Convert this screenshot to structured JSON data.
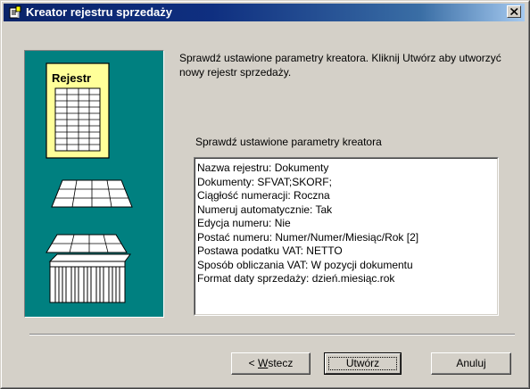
{
  "window": {
    "title": "Kreator rejestru sprzedaży",
    "title_icon": "wizard-document-icon",
    "close_icon": "close-icon"
  },
  "picture": {
    "label": "Rejestr",
    "background": "#008080",
    "highlight": "#ffff99"
  },
  "instructions": "Sprawdź ustawione parametry kreatora. Kliknij Utwórz aby utworzyć nowy rejestr sprzedaży.",
  "summary": {
    "label": "Sprawdź ustawione parametry kreatora",
    "items": [
      "Nazwa rejestru: Dokumenty",
      "Dokumenty: SFVAT;SKORF;",
      "Ciągłość numeracji: Roczna",
      "Numeruj automatycznie: Tak",
      "Edycja numeru: Nie",
      "Postać numeru: Numer/Numer/Miesiąc/Rok [2]",
      "Postawa podatku VAT: NETTO",
      "Sposób obliczania VAT: W pozycji dokumentu",
      "Format daty sprzedaży: dzień.miesiąc.rok"
    ]
  },
  "buttons": {
    "back_prefix": "< ",
    "back_mnemonic": "W",
    "back_rest": "stecz",
    "create": "Utwórz",
    "cancel": "Anuluj"
  },
  "colors": {
    "titlebar_start": "#0a246a",
    "titlebar_end": "#a6caf0",
    "face": "#d4d0c8"
  }
}
